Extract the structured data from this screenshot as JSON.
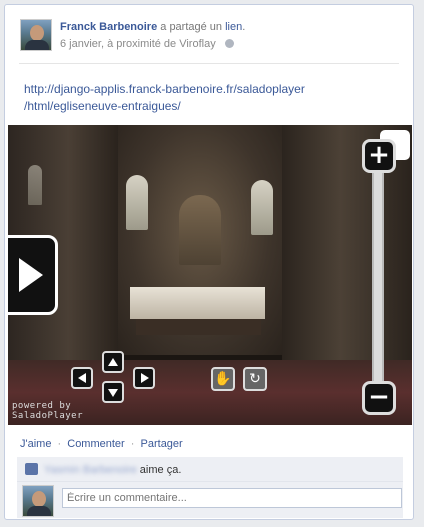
{
  "post": {
    "author": "Franck Barbenoire",
    "action": "a partagé un",
    "object_link": "lien",
    "object_suffix": ".",
    "date": "6 janvier, à proximité de Viroflay",
    "url_line1": "http://django-applis.franck-barbenoire.fr/saladoplayer",
    "url_line2": "/html/egliseneuve-entraigues/"
  },
  "player": {
    "powered_line1": "powered by",
    "powered_line2": "SaladoPlayer",
    "zoom_in": "+",
    "zoom_out": "−",
    "hand_glyph": "✋",
    "refresh_glyph": "↻"
  },
  "actions": {
    "like": "J'aime",
    "comment": "Commenter",
    "share": "Partager",
    "separator": "·"
  },
  "likes": {
    "names": "Yasmin Barbenoire",
    "text": "aime ça."
  },
  "comment": {
    "placeholder": "Écrire un commentaire..."
  },
  "colors": {
    "link": "#3b5998",
    "panel": "#edeff4",
    "background": "#e9ebee"
  }
}
